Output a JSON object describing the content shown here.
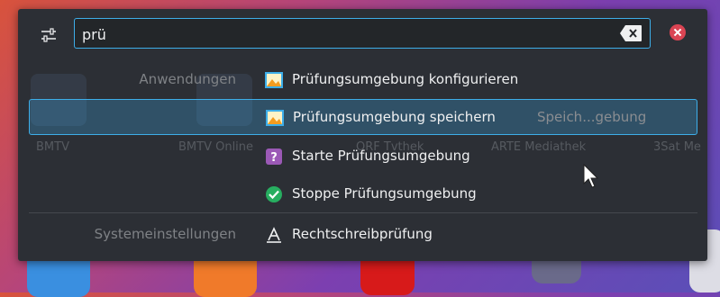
{
  "search": {
    "value": "prü",
    "settings_icon": "settings-sliders-icon",
    "clear_icon": "backspace-clear-icon",
    "close_icon": "close-circle-icon"
  },
  "background": {
    "labels": [
      "BMTV",
      "BMTV Online",
      "ORF Tvthek",
      "ARTE Mediathek",
      "3Sat Me"
    ]
  },
  "categories": [
    {
      "name": "Anwendungen",
      "results": [
        {
          "label": "Prüfungsumgebung konfigurieren",
          "sublabel": "",
          "icon": "application-picture-icon",
          "selected": false
        },
        {
          "label": "Prüfungsumgebung speichern",
          "sublabel": "Speich...gebung",
          "icon": "application-picture-icon",
          "selected": true
        },
        {
          "label": "Starte Prüfungsumgebung",
          "sublabel": "",
          "icon": "question-mark-icon",
          "selected": false
        },
        {
          "label": "Stoppe Prüfungsumgebung",
          "sublabel": "",
          "icon": "green-check-icon",
          "selected": false
        }
      ]
    },
    {
      "name": "Systemeinstellungen",
      "results": [
        {
          "label": "Rechtschreibprüfung",
          "sublabel": "",
          "icon": "spellcheck-icon",
          "selected": false
        }
      ]
    }
  ],
  "colors": {
    "accent": "#3daee9",
    "panel": "#2c2f35",
    "close": "#da4453",
    "check": "#27ae60",
    "question": "#9b59b6"
  }
}
